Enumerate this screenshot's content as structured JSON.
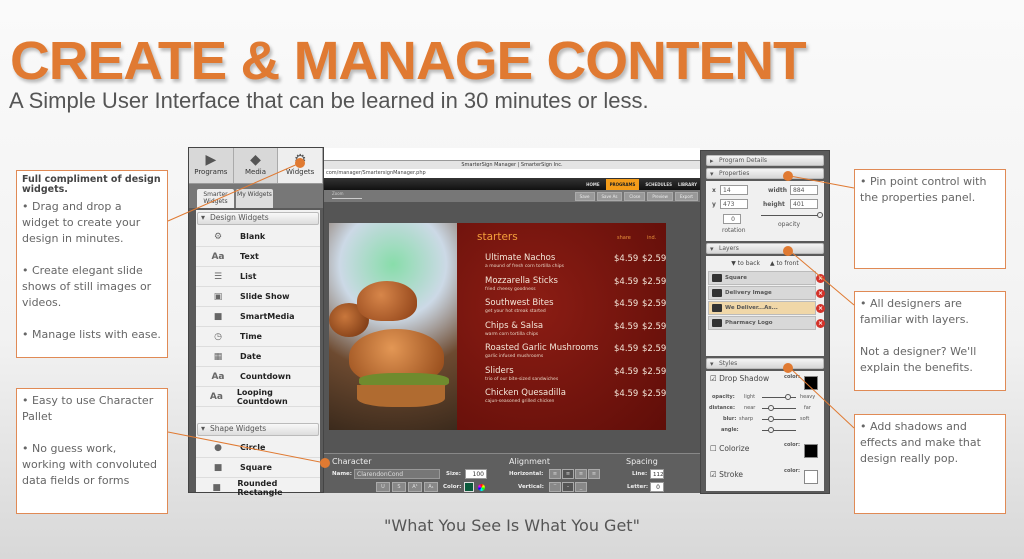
{
  "header": {
    "title": "CREATE & MANAGE CONTENT",
    "subtitle": "A Simple User Interface that can be learned in 30 minutes or less."
  },
  "footer": {
    "tagline": "\"What You See Is What You Get\""
  },
  "callouts": {
    "widgets": {
      "heading": "Full compliment of design widgets.",
      "points": [
        "• Drag and drop a widget to create your design in minutes.",
        "• Create elegant slide shows of still images or videos.",
        "• Manage lists with ease."
      ]
    },
    "character": {
      "points": [
        "• Easy to use Character Pallet",
        "• No guess work, working with convoluted data fields or forms"
      ]
    },
    "properties": {
      "points": [
        "• Pin point control with the properties panel."
      ]
    },
    "layers": {
      "points": [
        "• All designers are familiar with layers.",
        "Not a designer? We'll explain the benefits."
      ]
    },
    "styles": {
      "points": [
        "• Add shadows and effects and make that design really pop."
      ]
    }
  },
  "left_panel": {
    "tabs": [
      {
        "label": "Programs",
        "icon": "programs-icon"
      },
      {
        "label": "Media",
        "icon": "media-icon"
      },
      {
        "label": "Widgets",
        "icon": "widgets-icon"
      }
    ],
    "subtabs": [
      "Smarter Widgets",
      "My Widgets"
    ],
    "design_section": "Design Widgets",
    "design_widgets": [
      {
        "label": "Blank",
        "icon": "⚙"
      },
      {
        "label": "Text",
        "icon": "Aa"
      },
      {
        "label": "List",
        "icon": "☰"
      },
      {
        "label": "Slide Show",
        "icon": "▣"
      },
      {
        "label": "SmartMedia",
        "icon": "■"
      },
      {
        "label": "Time",
        "icon": "◷"
      },
      {
        "label": "Date",
        "icon": "▦"
      },
      {
        "label": "Countdown",
        "icon": "Aa"
      },
      {
        "label": "Looping Countdown",
        "icon": "Aa"
      }
    ],
    "shape_section": "Shape Widgets",
    "shape_widgets": [
      {
        "label": "Circle",
        "icon": "●"
      },
      {
        "label": "Square",
        "icon": "■"
      },
      {
        "label": "Rounded Rectangle",
        "icon": "■"
      }
    ]
  },
  "editor": {
    "window_title": "SmarterSign Manager | SmarterSign Inc.",
    "url": "com/manager/SmartersignManager.php",
    "nav": [
      "HOME",
      "PROGRAMS",
      "SCHEDULES",
      "LIBRARY"
    ],
    "nav_active": "PROGRAMS",
    "zoom_label": "Zoom",
    "toolbar": [
      "Save",
      "Save As",
      "Close",
      "Preview",
      "Export"
    ],
    "accent": "#f39c1a"
  },
  "menu": {
    "heading": "starters",
    "col_share": "share",
    "col_ind": "ind.",
    "items": [
      {
        "name": "Ultimate Nachos",
        "desc": "a mound of fresh corn tortilla chips",
        "share": "$4.59",
        "ind": "$2.59"
      },
      {
        "name": "Mozzarella Sticks",
        "desc": "fried cheesy goodness",
        "share": "$4.59",
        "ind": "$2.59"
      },
      {
        "name": "Southwest Bites",
        "desc": "get your hot streak started",
        "share": "$4.59",
        "ind": "$2.59"
      },
      {
        "name": "Chips & Salsa",
        "desc": "warm corn tortilla chips",
        "share": "$4.59",
        "ind": "$2.59"
      },
      {
        "name": "Roasted Garlic Mushrooms",
        "desc": "garlic infused mushrooms",
        "share": "$4.59",
        "ind": "$2.59"
      },
      {
        "name": "Sliders",
        "desc": "trio of our bite-sized sandwiches",
        "share": "$4.59",
        "ind": "$2.59"
      },
      {
        "name": "Chicken Quesadilla",
        "desc": "cajun-seasoned grilled chicken",
        "share": "$4.59",
        "ind": "$2.59"
      }
    ]
  },
  "character": {
    "heading": "Character",
    "name_label": "Name:",
    "font_value": "ClarendonCond",
    "size_label": "Size:",
    "size_value": "100",
    "color_label": "Color:",
    "style_buttons": [
      "U",
      "S",
      "A¹",
      "A₁"
    ],
    "alignment_heading": "Alignment",
    "horizontal_label": "Horizontal:",
    "vertical_label": "Vertical:",
    "spacing_heading": "Spacing",
    "line_label": "Line:",
    "line_value": "112",
    "letter_label": "Letter:",
    "letter_value": "0"
  },
  "right_panel": {
    "program_details": "Program Details",
    "properties": "Properties",
    "x_label": "x",
    "x_value": "14",
    "y_label": "y",
    "y_value": "473",
    "width_label": "width",
    "width_value": "884",
    "height_label": "height",
    "height_value": "401",
    "opacity_label": "opacity",
    "rotation_label": "rotation",
    "rotation_value": "0",
    "layers_heading": "Layers",
    "to_back": "▼ to back",
    "to_front": "▲ to front",
    "layers": [
      {
        "name": "Square",
        "selected": false
      },
      {
        "name": "Delivery Image",
        "selected": false
      },
      {
        "name": "We Deliver...As...",
        "selected": true
      },
      {
        "name": "Pharmacy Logo",
        "selected": false
      }
    ],
    "styles_heading": "Styles",
    "drop_shadow": "Drop Shadow",
    "color_label": "color:",
    "opacity_row": [
      "opacity:",
      "light",
      "heavy"
    ],
    "distance_row": [
      "distance:",
      "near",
      "far"
    ],
    "blur_row": [
      "blur:",
      "sharp",
      "soft"
    ],
    "angle_label": "angle:",
    "colorize": "Colorize",
    "stroke": "Stroke"
  }
}
